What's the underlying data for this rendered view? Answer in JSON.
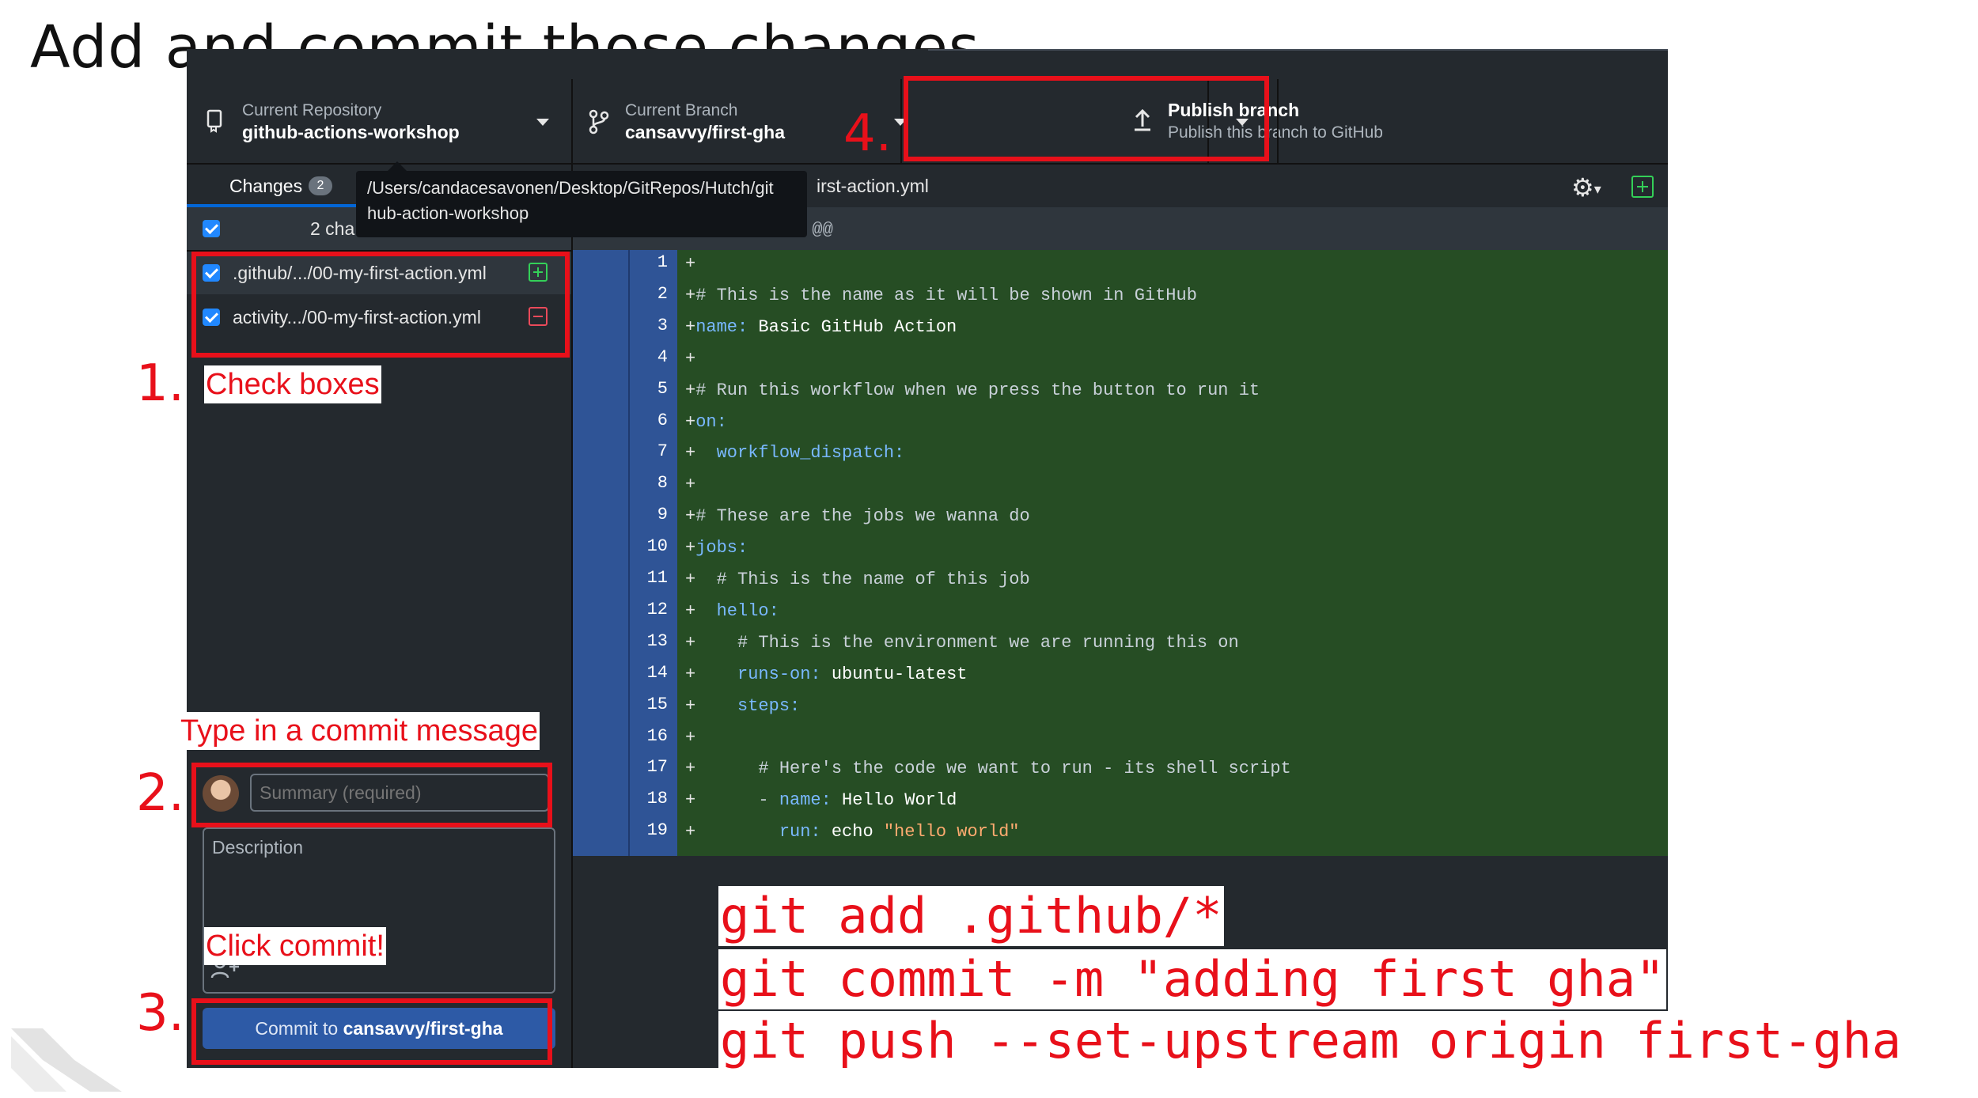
{
  "slide": {
    "title": "Add and commit those changes"
  },
  "toolbar": {
    "repo_label": "Current Repository",
    "repo_value": "github-actions-workshop",
    "branch_label": "Current Branch",
    "branch_value": "cansavvy/first-gha",
    "publish_label": "Publish branch",
    "publish_desc": "Publish this branch to GitHub"
  },
  "sidebar": {
    "tab_label": "Changes",
    "tab_count": "2",
    "header_text": "2 cha",
    "files": [
      {
        "name": ".github/.../00-my-first-action.yml",
        "status": "added",
        "checked": true
      },
      {
        "name": "activity.../00-my-first-action.yml",
        "status": "deleted",
        "checked": true
      }
    ]
  },
  "tooltip": {
    "line1": "/Users/candacesavonen/Desktop/GitRepos/Hutch/git",
    "line2": "hub-action-workshop"
  },
  "commit": {
    "summary_placeholder": "Summary (required)",
    "description_label": "Description",
    "button_prefix": "Commit to ",
    "button_branch": "cansavvy/first-gha"
  },
  "diff": {
    "file_name": "irst-action.yml",
    "hunk": "@@ -0,0 +1,19 @@",
    "hunk_visible": "0 @@",
    "lines": [
      {
        "n": "1",
        "plus": "+",
        "parts": []
      },
      {
        "n": "2",
        "plus": "+",
        "parts": [
          {
            "t": "# This is the name as it will be shown in GitHub",
            "c": "c-comment"
          }
        ]
      },
      {
        "n": "3",
        "plus": "+",
        "parts": [
          {
            "t": "name:",
            "c": "c-key"
          },
          {
            "t": " Basic GitHub Action",
            "c": "c-val"
          }
        ]
      },
      {
        "n": "4",
        "plus": "+",
        "parts": []
      },
      {
        "n": "5",
        "plus": "+",
        "parts": [
          {
            "t": "# Run this workflow when we press the button to run it",
            "c": "c-comment"
          }
        ]
      },
      {
        "n": "6",
        "plus": "+",
        "parts": [
          {
            "t": "on:",
            "c": "c-key"
          }
        ]
      },
      {
        "n": "7",
        "plus": "+",
        "parts": [
          {
            "t": "  workflow_dispatch:",
            "c": "c-key"
          }
        ]
      },
      {
        "n": "8",
        "plus": "+",
        "parts": []
      },
      {
        "n": "9",
        "plus": "+",
        "parts": [
          {
            "t": "# These are the jobs we wanna do",
            "c": "c-comment"
          }
        ]
      },
      {
        "n": "10",
        "plus": "+",
        "parts": [
          {
            "t": "jobs:",
            "c": "c-key"
          }
        ]
      },
      {
        "n": "11",
        "plus": "+",
        "parts": [
          {
            "t": "  # This is the name of this job",
            "c": "c-comment"
          }
        ]
      },
      {
        "n": "12",
        "plus": "+",
        "parts": [
          {
            "t": "  hello:",
            "c": "c-key"
          }
        ]
      },
      {
        "n": "13",
        "plus": "+",
        "parts": [
          {
            "t": "    # This is the environment we are running this on",
            "c": "c-comment"
          }
        ]
      },
      {
        "n": "14",
        "plus": "+",
        "parts": [
          {
            "t": "    runs-on:",
            "c": "c-key"
          },
          {
            "t": " ubuntu-latest",
            "c": "c-val"
          }
        ]
      },
      {
        "n": "15",
        "plus": "+",
        "parts": [
          {
            "t": "    steps:",
            "c": "c-key"
          }
        ]
      },
      {
        "n": "16",
        "plus": "+",
        "parts": []
      },
      {
        "n": "17",
        "plus": "+",
        "parts": [
          {
            "t": "      # Here's the code we want to run - its shell script",
            "c": "c-comment"
          }
        ]
      },
      {
        "n": "18",
        "plus": "+",
        "parts": [
          {
            "t": "      - ",
            "c": "c-comment"
          },
          {
            "t": "name:",
            "c": "c-key"
          },
          {
            "t": " Hello World",
            "c": "c-val"
          }
        ]
      },
      {
        "n": "19",
        "plus": "+",
        "parts": [
          {
            "t": "        run:",
            "c": "c-key"
          },
          {
            "t": " echo ",
            "c": "c-val"
          },
          {
            "t": "\"hello world\"",
            "c": "c-str"
          }
        ]
      }
    ]
  },
  "annotations": {
    "step1": "1.",
    "step2": "2.",
    "step3": "3.",
    "step4": "4.",
    "check_boxes": "Check boxes",
    "type_message": "Type in a commit message",
    "click_commit": "Click commit!"
  },
  "commands": [
    "git add .github/*",
    "git commit -m \"adding first gha\"",
    "git push --set-upstream origin first-gha"
  ],
  "colors": {
    "annotation_red": "#e8101a",
    "app_bg": "#24292e",
    "diff_add_bg": "#264d24",
    "gutter_blue": "#2f5496",
    "commit_button": "#2d5aa6"
  }
}
